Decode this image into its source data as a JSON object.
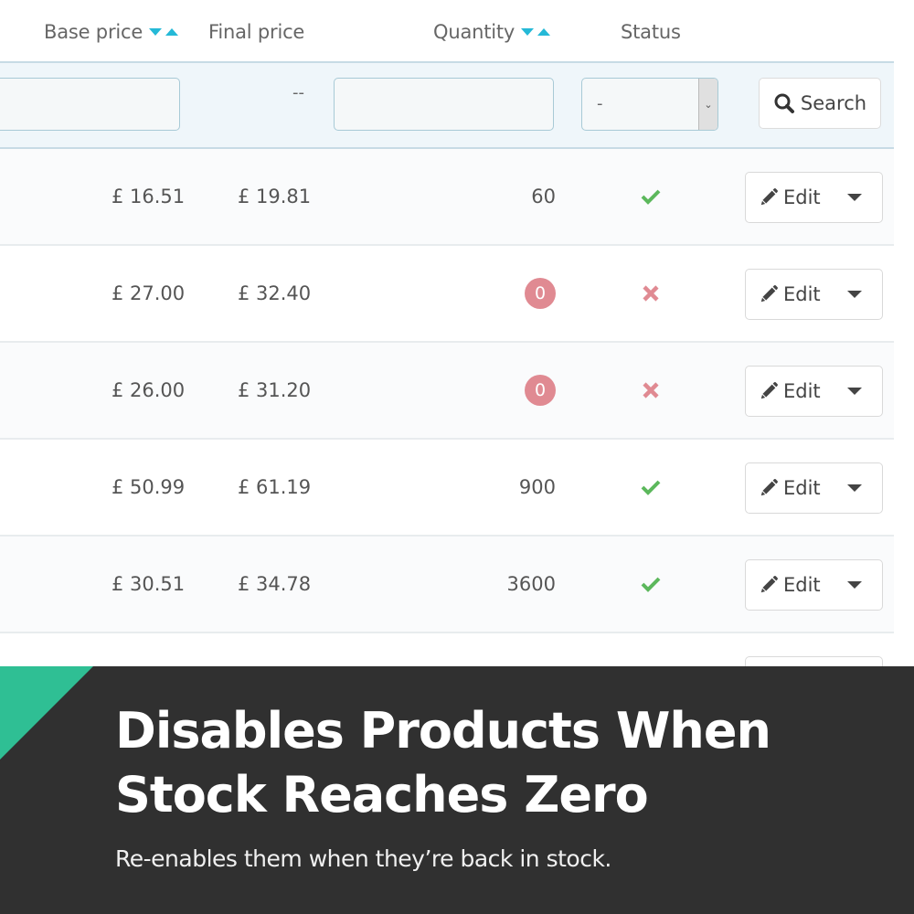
{
  "table": {
    "columns": {
      "base_price": "Base price",
      "final_price": "Final price",
      "quantity": "Quantity",
      "status": "Status"
    },
    "filters": {
      "base_price_value": "",
      "final_price_placeholder": "--",
      "quantity_value": "",
      "status_selected": "-",
      "search_label": "Search"
    },
    "rows": [
      {
        "base_price": "£ 16.51",
        "final_price": "£ 19.81",
        "quantity": "60",
        "quantity_zero": false,
        "status": "enabled",
        "edit_label": "Edit"
      },
      {
        "base_price": "£ 27.00",
        "final_price": "£ 32.40",
        "quantity": "0",
        "quantity_zero": true,
        "status": "disabled",
        "edit_label": "Edit"
      },
      {
        "base_price": "£ 26.00",
        "final_price": "£ 31.20",
        "quantity": "0",
        "quantity_zero": true,
        "status": "disabled",
        "edit_label": "Edit"
      },
      {
        "base_price": "£ 50.99",
        "final_price": "£ 61.19",
        "quantity": "900",
        "quantity_zero": false,
        "status": "enabled",
        "edit_label": "Edit"
      },
      {
        "base_price": "£ 30.51",
        "final_price": "£ 34.78",
        "quantity": "3600",
        "quantity_zero": false,
        "status": "enabled",
        "edit_label": "Edit"
      }
    ]
  },
  "icons": {
    "sort_desc": "sort-desc-icon",
    "sort_asc": "sort-asc-icon",
    "search": "search-icon",
    "pencil": "pencil-icon",
    "check": "check-icon",
    "cross": "cross-icon",
    "caret": "caret-down-icon"
  },
  "colors": {
    "accent_blue": "#25b9d7",
    "enabled_green": "#5cb85c",
    "disabled_red": "#e08a92",
    "banner_bg": "#303030",
    "banner_accent": "#2fbf94"
  },
  "banner": {
    "headline": "Disables Products When Stock Reaches Zero",
    "subline": "Re-enables them when they’re back in stock."
  }
}
